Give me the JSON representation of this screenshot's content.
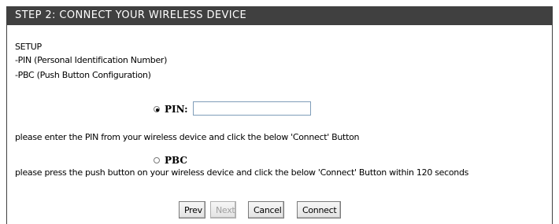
{
  "header": {
    "title": "STEP 2: CONNECT YOUR WIRELESS DEVICE"
  },
  "setup": {
    "title": "SETUP",
    "lines": [
      "-PIN (Personal Identification Number)",
      "-PBC (Push Button Configuration)"
    ]
  },
  "pin_option": {
    "label": "PIN:",
    "selected": true,
    "value": "",
    "help": "please enter the PIN from your wireless device and click the below 'Connect' Button"
  },
  "pbc_option": {
    "label": "PBC",
    "selected": false,
    "help": "please press the push button on your wireless device and click the below 'Connect' Button within 120 seconds"
  },
  "buttons": {
    "prev": "Prev",
    "next": "Next",
    "cancel": "Cancel",
    "connect": "Connect"
  },
  "colors": {
    "header_bg": "#404040",
    "header_text": "#ffffff",
    "disabled_text": "#a0a0a0"
  }
}
